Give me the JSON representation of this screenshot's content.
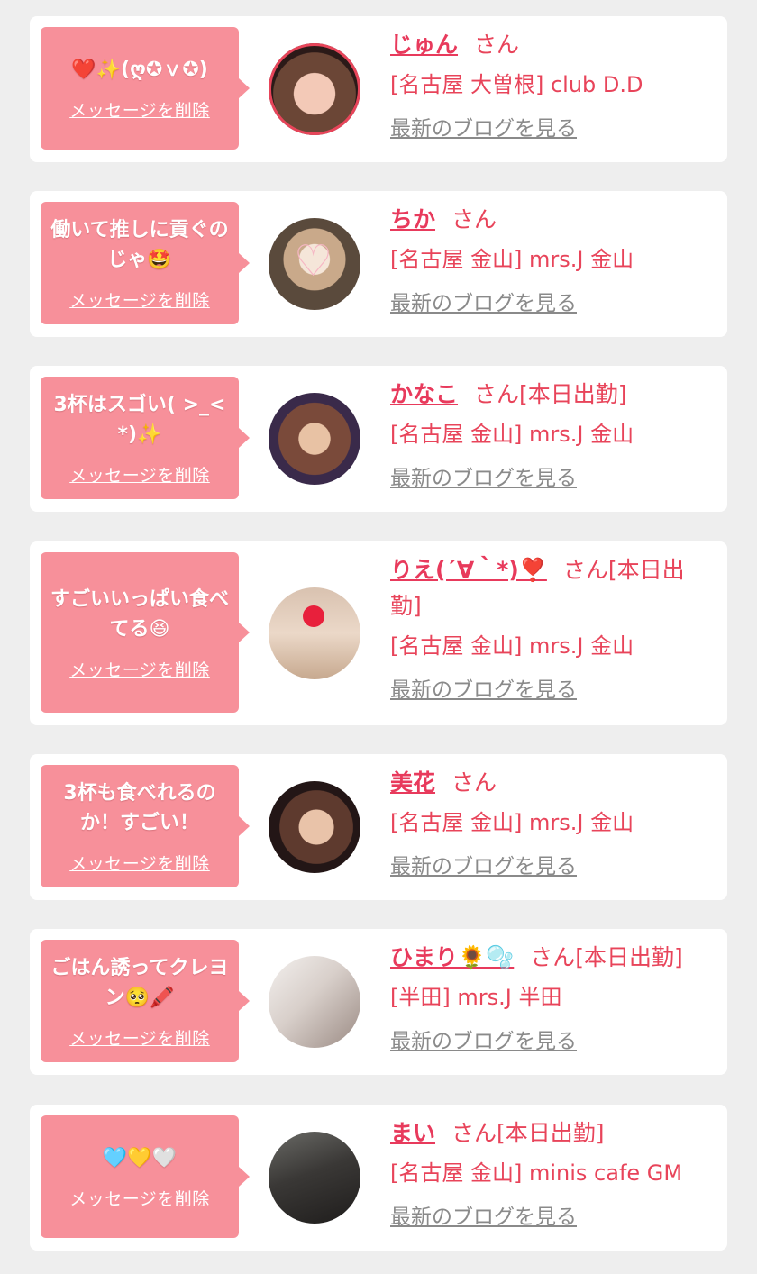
{
  "colors": {
    "page_background": "#eeeeee",
    "card_background": "#ffffff",
    "bubble": "#f7909a",
    "accent_text": "#e8445a",
    "link_gray": "#8a8a8a"
  },
  "delete_label": "メッセージを削除",
  "blog_label": "最新のブログを見る",
  "entries": [
    {
      "message": "❤️✨(ღ✪ｖ✪)",
      "name": "じゅん",
      "suffix": "さん",
      "shop": "[名古屋 大曽根] club D.D",
      "avatar": "photo-avatar-jun"
    },
    {
      "message": "働いて推しに貢ぐのじゃ🤩",
      "name": "ちか",
      "suffix": "さん",
      "shop": "[名古屋 金山] mrs.J 金山",
      "avatar": "photo-avatar-chika"
    },
    {
      "message": "3杯はスゴい( >_< *)✨",
      "name": "かなこ",
      "suffix": "さん[本日出勤]",
      "shop": "[名古屋 金山] mrs.J 金山",
      "avatar": "photo-avatar-kanako"
    },
    {
      "message": "すごいいっぱい食べてる😆",
      "name": "りえ(´∀｀*)❣️",
      "suffix": "さん[本日出勤]",
      "shop": "[名古屋 金山] mrs.J 金山",
      "avatar": "photo-avatar-rie"
    },
    {
      "message": "3杯も食べれるのか！すごい！",
      "name": "美花",
      "suffix": "さん",
      "shop": "[名古屋 金山] mrs.J 金山",
      "avatar": "photo-avatar-mika"
    },
    {
      "message": "ごはん誘ってクレヨン🥺🖍️",
      "name": "ひまり🌻🫧",
      "suffix": "さん[本日出勤]",
      "shop": "[半田] mrs.J 半田",
      "avatar": "photo-avatar-himari"
    },
    {
      "message": "🩵💛🤍",
      "name": "まい",
      "suffix": "さん[本日出勤]",
      "shop": "[名古屋 金山] minis cafe GM",
      "avatar": "photo-avatar-mai"
    }
  ]
}
